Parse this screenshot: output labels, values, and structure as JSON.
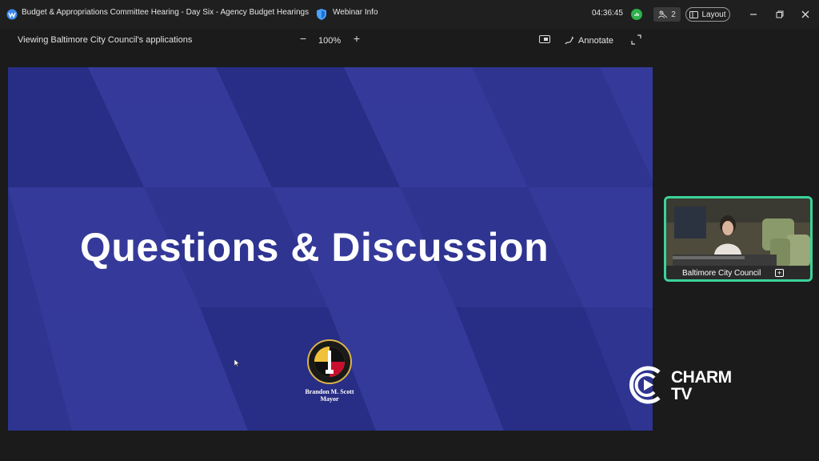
{
  "titlebar": {
    "meeting_title": "Budget & Appropriations Committee Hearing - Day Six - Agency Budget Hearings",
    "webinar_info": "Webinar Info",
    "clock": "04:36:45",
    "participant_count": "2",
    "layout_label": "Layout"
  },
  "toolbar": {
    "viewing_text": "Viewing Baltimore City Council's applications",
    "zoom_level": "100%",
    "zoom_minus": "−",
    "zoom_plus": "+",
    "annotate_label": "Annotate"
  },
  "slide": {
    "title": "Questions & Discussion",
    "mayor_name": "Brandon M. Scott",
    "mayor_title": "Mayor",
    "seal_text": "CITY OF BALTIMORE"
  },
  "video": {
    "participant_label": "Baltimore City Council"
  },
  "watermark": {
    "line1": "CHARM",
    "line2": "TV"
  },
  "colors": {
    "slide_bg": "#2e3490",
    "active_speaker_border": "#3bd39a",
    "recording": "#2fb24a"
  }
}
